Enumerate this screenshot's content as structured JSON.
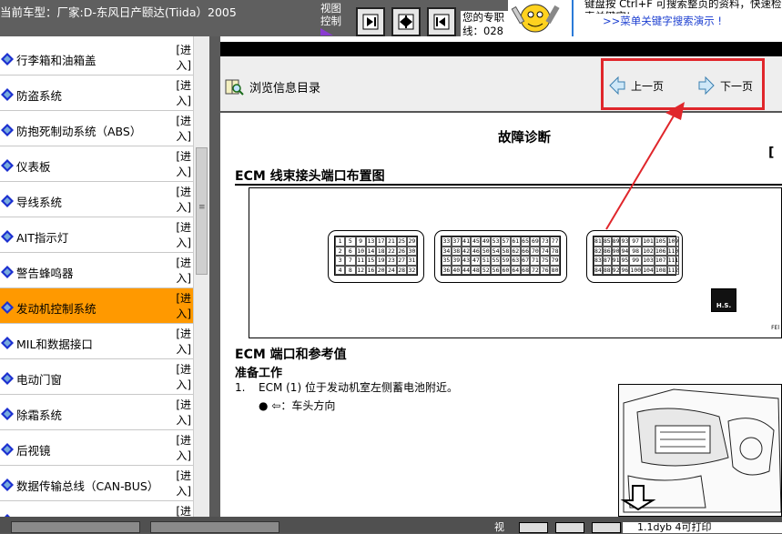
{
  "header": {
    "car_model": "当前车型：厂家:D-东风日产颐达(Tiida）2005",
    "view_control_label": "视图控制",
    "tip_text": "您的专职线：028",
    "search_promo_text": "键盘按 Ctrl+F 可搜索整页的资料，快速检索关键字!",
    "search_promo_link": ">>菜单关键字搜索演示 !"
  },
  "sidebar": {
    "items": [
      {
        "label": "行李箱和油箱盖",
        "enter": "[进入]",
        "active": false
      },
      {
        "label": "防盗系统",
        "enter": "[进入]",
        "active": false
      },
      {
        "label": "防抱死制动系统（ABS）",
        "enter": "[进入]",
        "active": false
      },
      {
        "label": "仪表板",
        "enter": "[进入]",
        "active": false
      },
      {
        "label": "导线系统",
        "enter": "[进入]",
        "active": false
      },
      {
        "label": "AIT指示灯",
        "enter": "[进入]",
        "active": false
      },
      {
        "label": "警告蜂鸣器",
        "enter": "[进入]",
        "active": false
      },
      {
        "label": "发动机控制系统",
        "enter": "[进入]",
        "active": true
      },
      {
        "label": "MIL和数据接口",
        "enter": "[进入]",
        "active": false
      },
      {
        "label": "电动门窗",
        "enter": "[进入]",
        "active": false
      },
      {
        "label": "除霜系统",
        "enter": "[进入]",
        "active": false
      },
      {
        "label": "后视镜",
        "enter": "[进入]",
        "active": false
      },
      {
        "label": "数据传输总线（CAN-BUS）",
        "enter": "[进入]",
        "active": false
      },
      {
        "label": "",
        "enter": "[进",
        "active": false
      }
    ]
  },
  "toolbar": {
    "toc_label": "浏览信息目录",
    "prev_label": "上一页",
    "next_label": "下一页"
  },
  "document": {
    "title": "故障诊断",
    "bracket": "[",
    "section1": "ECM 线束接头端口布置图",
    "figure_code": "FEl",
    "hs_label": "H.S.",
    "section2": "ECM 端口和参考值",
    "prep_title": "准备工作",
    "step1_num": "1.",
    "step1_text": "ECM (1) 位于发动机室左侧蓄电池附近。",
    "bullet_text": "● ⇦：车头方向",
    "connector1": [
      "1",
      "5",
      "9",
      "13",
      "17",
      "21",
      "25",
      "29",
      "2",
      "6",
      "10",
      "14",
      "18",
      "22",
      "26",
      "30",
      "3",
      "7",
      "11",
      "15",
      "19",
      "23",
      "27",
      "31",
      "4",
      "8",
      "12",
      "16",
      "20",
      "24",
      "28",
      "32"
    ],
    "connector2": [
      "33",
      "37",
      "41",
      "45",
      "49",
      "53",
      "57",
      "61",
      "65",
      "69",
      "73",
      "77",
      "34",
      "38",
      "42",
      "46",
      "50",
      "54",
      "58",
      "62",
      "66",
      "70",
      "74",
      "78",
      "35",
      "39",
      "43",
      "47",
      "51",
      "55",
      "59",
      "63",
      "67",
      "71",
      "75",
      "79",
      "36",
      "40",
      "44",
      "48",
      "52",
      "56",
      "60",
      "64",
      "68",
      "72",
      "76",
      "80"
    ],
    "connector3": [
      "81",
      "85",
      "89",
      "93",
      "97",
      "101",
      "105",
      "109",
      "82",
      "86",
      "90",
      "94",
      "98",
      "102",
      "106",
      "110",
      "83",
      "87",
      "91",
      "95",
      "99",
      "103",
      "107",
      "111",
      "84",
      "88",
      "92",
      "96",
      "100",
      "104",
      "108",
      "112"
    ]
  },
  "footer": {
    "view_label": "视",
    "print_text": "1.1dyb 4可打印"
  },
  "colors": {
    "active_item": "#ff9900",
    "highlight_box": "#e0262b",
    "diamond_fill": "#1b2fd0"
  }
}
